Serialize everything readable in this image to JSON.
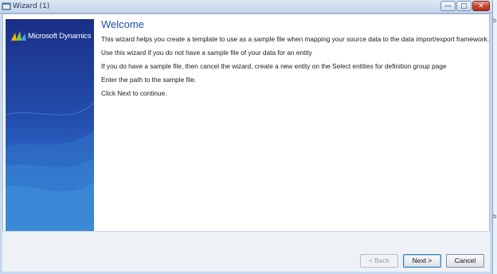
{
  "window": {
    "title": "Wizard (1)",
    "controls": {
      "minimize": "—",
      "maximize": "▢",
      "close": "✕"
    }
  },
  "banner": {
    "brand": "Microsoft Dynamics"
  },
  "content": {
    "heading": "Welcome",
    "paragraphs": [
      "This wizard helps you create a template to use as a sample file when mapping your source data to the data import/export framework.",
      "Use this wizard if you do not have a sample file of your data for an entity",
      "If you do have a sample file, then cancel the wizard, create a new entity on the Select entities for definition group page",
      "Enter the path to the sample file.",
      "Click Next to continue."
    ]
  },
  "footer": {
    "back_label": "< Back",
    "next_label": "Next >",
    "cancel_label": "Cancel"
  },
  "edge": {
    "fragment_1": "b",
    "fragment_2": "b"
  },
  "colors": {
    "heading": "#1c4fa6",
    "banner_top": "#1a2f86",
    "banner_bottom": "#3078cc",
    "close_button": "#c2412d"
  }
}
